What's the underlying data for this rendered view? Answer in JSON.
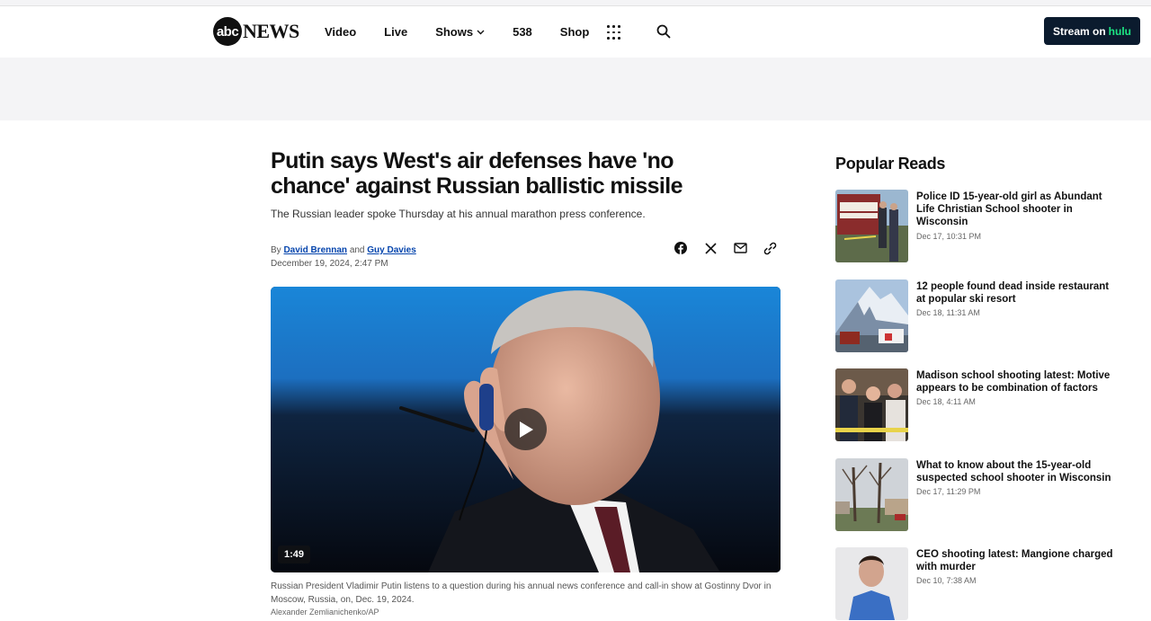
{
  "brand": {
    "logo_mark": "abc",
    "logo_word": "NEWS"
  },
  "nav": {
    "links": [
      "Video",
      "Live",
      "Shows",
      "538",
      "Shop"
    ],
    "shows_chevron": "chevron-down-icon",
    "apps_icon": "grid-icon",
    "search_icon": "search-icon",
    "stream_label": "Stream on",
    "stream_brand": "hulu"
  },
  "article": {
    "headline": "Putin says West's air defenses have 'no chance' against Russian ballistic missile",
    "dek": "The Russian leader spoke Thursday at his annual marathon press conference.",
    "byline_prefix": "By",
    "author1": "David Brennan",
    "byline_and": "and",
    "author2": "Guy Davies",
    "date": "December 19, 2024, 2:47 PM",
    "share_icons": [
      "facebook-icon",
      "x-icon",
      "email-icon",
      "link-icon"
    ],
    "video": {
      "duration": "1:49",
      "caption": "Russian President Vladimir Putin listens to a question during his annual news conference and call-in show at Gostinny Dvor in Moscow, Russia, on, Dec. 19, 2024.",
      "credit": "Alexander Zemlianichenko/AP"
    }
  },
  "popular": {
    "title": "Popular Reads",
    "items": [
      {
        "headline": "Police ID 15-year-old girl as Abundant Life Christian School shooter in Wisconsin",
        "time": "Dec 17, 10:31 PM"
      },
      {
        "headline": "12 people found dead inside restaurant at popular ski resort",
        "time": "Dec 18, 11:31 AM"
      },
      {
        "headline": "Madison school shooting latest: Motive appears to be combination of factors",
        "time": "Dec 18, 4:11 AM"
      },
      {
        "headline": "What to know about the 15-year-old suspected school shooter in Wisconsin",
        "time": "Dec 17, 11:29 PM"
      },
      {
        "headline": "CEO shooting latest: Mangione charged with murder",
        "time": "Dec 10, 7:38 AM"
      }
    ]
  },
  "colors": {
    "stream_bg": "#0b1b2e",
    "hulu_green": "#1ce783",
    "link_blue": "#0645ad",
    "ad_band": "#f4f4f6"
  }
}
